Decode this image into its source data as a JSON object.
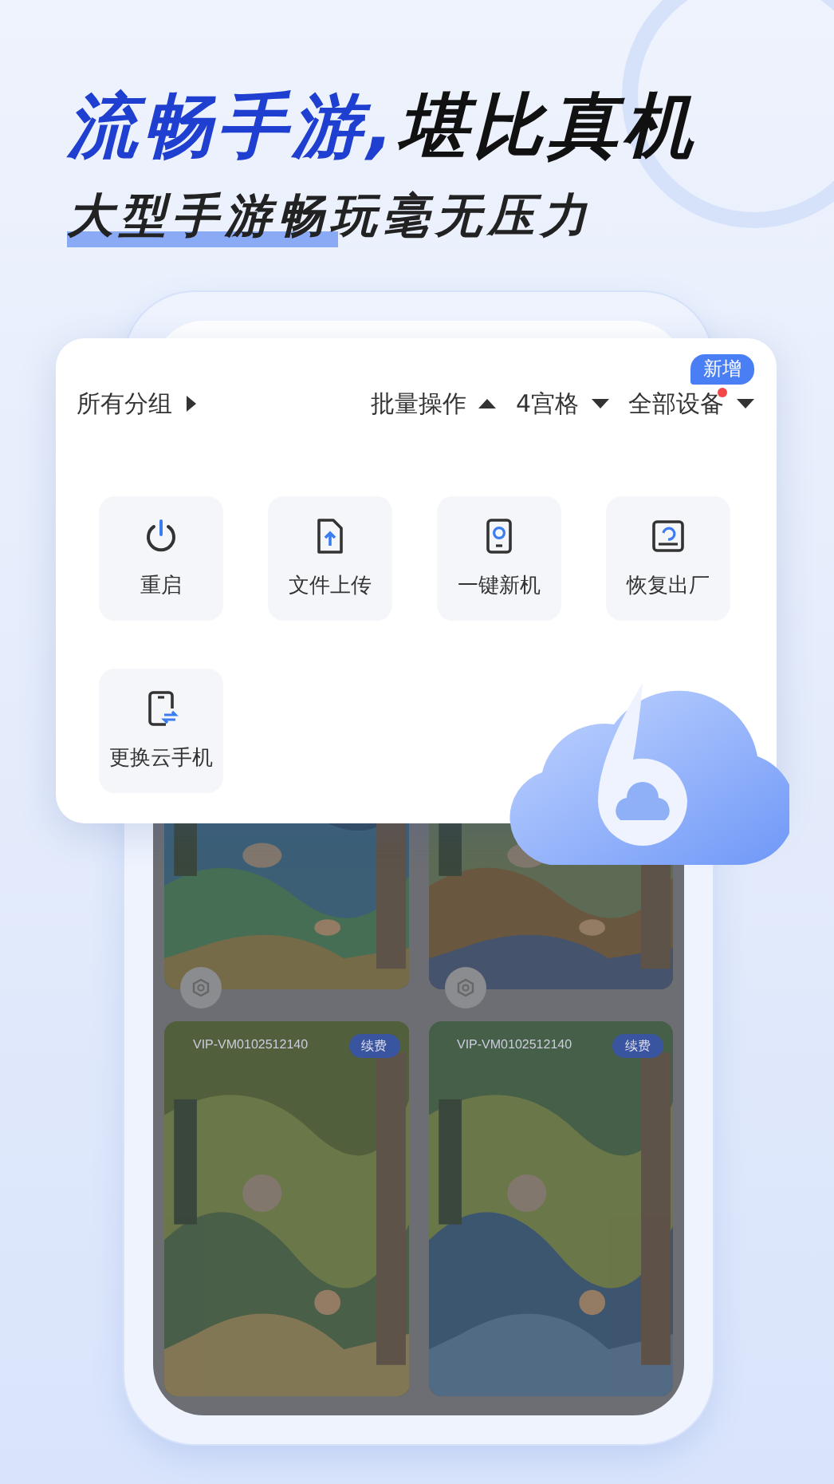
{
  "headline": {
    "highlight": "流畅手游,",
    "rest": "堪比真机"
  },
  "subtitle": "大型手游畅玩毫无压力",
  "toolbar": {
    "group_filter": "所有分组",
    "batch": "批量操作",
    "grid": "4宫格",
    "devices": "全部设备",
    "new_badge": "新增"
  },
  "actions": [
    {
      "label": "重启"
    },
    {
      "label": "文件上传"
    },
    {
      "label": "一键新机"
    },
    {
      "label": "恢复出厂"
    },
    {
      "label": "更换云手机"
    }
  ],
  "devices": [
    {
      "kind": "picture"
    },
    {
      "kind": "picture"
    },
    {
      "kind": "picture",
      "device_id": "VIP-VM0102512140",
      "renew": "续费"
    },
    {
      "kind": "picture",
      "device_id": "VIP-VM0102512140",
      "renew": "续费"
    }
  ]
}
